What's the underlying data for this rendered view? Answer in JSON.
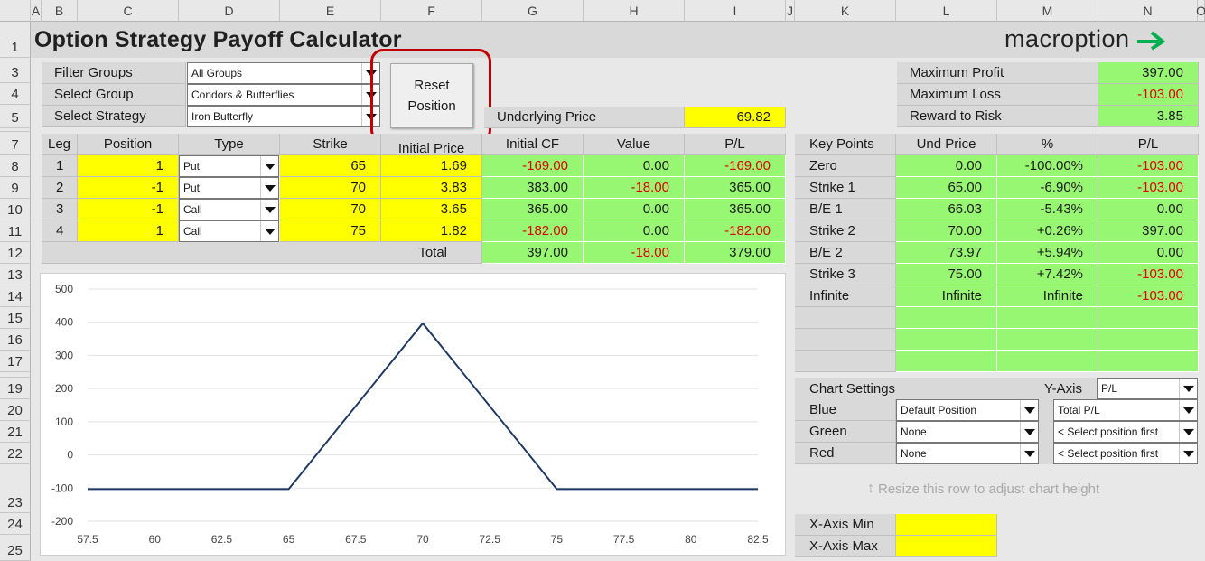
{
  "column_headers": [
    "A",
    "B",
    "C",
    "D",
    "E",
    "F",
    "G",
    "H",
    "I",
    "J",
    "K",
    "L",
    "M",
    "N",
    "O"
  ],
  "row_headers": [
    "1",
    "3",
    "4",
    "5",
    "7",
    "8",
    "9",
    "10",
    "11",
    "12",
    "13",
    "14",
    "15",
    "16",
    "17",
    "19",
    "20",
    "21",
    "22",
    "23",
    "24",
    "25"
  ],
  "title": "Option Strategy Payoff Calculator",
  "logo": {
    "text": "macroption",
    "accent": "#00b050"
  },
  "filters": [
    {
      "label": "Filter Groups",
      "value": "All Groups"
    },
    {
      "label": "Select Group",
      "value": "Condors & Butterflies"
    },
    {
      "label": "Select Strategy",
      "value": "Iron Butterfly"
    }
  ],
  "reset_button": {
    "line1": "Reset",
    "line2": "Position"
  },
  "underlying": {
    "label": "Underlying Price",
    "value": "69.82"
  },
  "summary": [
    {
      "label": "Maximum Profit",
      "value": "397.00",
      "negative": false
    },
    {
      "label": "Maximum Loss",
      "value": "-103.00",
      "negative": true
    },
    {
      "label": "Reward to Risk",
      "value": "3.85",
      "negative": false
    }
  ],
  "legs_table": {
    "headers": [
      "Leg",
      "Position",
      "Type",
      "Strike",
      "Initial Price",
      "Initial CF",
      "Value",
      "P/L"
    ],
    "rows": [
      {
        "leg": "1",
        "position": "1",
        "type": "Put",
        "strike": "65",
        "price": "1.69",
        "cf": "-169.00",
        "value": "0.00",
        "pl": "-169.00"
      },
      {
        "leg": "2",
        "position": "-1",
        "type": "Put",
        "strike": "70",
        "price": "3.83",
        "cf": "383.00",
        "value": "-18.00",
        "pl": "365.00"
      },
      {
        "leg": "3",
        "position": "-1",
        "type": "Call",
        "strike": "70",
        "price": "3.65",
        "cf": "365.00",
        "value": "0.00",
        "pl": "365.00"
      },
      {
        "leg": "4",
        "position": "1",
        "type": "Call",
        "strike": "75",
        "price": "1.82",
        "cf": "-182.00",
        "value": "0.00",
        "pl": "-182.00"
      }
    ],
    "total": {
      "label": "Total",
      "cf": "397.00",
      "value": "-18.00",
      "pl": "379.00"
    }
  },
  "key_points": {
    "headers": [
      "Key Points",
      "Und Price",
      "%",
      "P/L"
    ],
    "rows": [
      {
        "name": "Zero",
        "und": "0.00",
        "pct": "-100.00%",
        "pl": "-103.00"
      },
      {
        "name": "Strike 1",
        "und": "65.00",
        "pct": "-6.90%",
        "pl": "-103.00"
      },
      {
        "name": "B/E 1",
        "und": "66.03",
        "pct": "-5.43%",
        "pl": "0.00"
      },
      {
        "name": "Strike 2",
        "und": "70.00",
        "pct": "+0.26%",
        "pl": "397.00"
      },
      {
        "name": "B/E 2",
        "und": "73.97",
        "pct": "+5.94%",
        "pl": "0.00"
      },
      {
        "name": "Strike 3",
        "und": "75.00",
        "pct": "+7.42%",
        "pl": "-103.00"
      },
      {
        "name": "Infinite",
        "und": "Infinite",
        "pct": "Infinite",
        "pl": "-103.00"
      }
    ]
  },
  "chart_settings": {
    "title": "Chart Settings",
    "yaxis_label": "Y-Axis",
    "yaxis_value": "P/L",
    "rows": [
      {
        "label": "Blue",
        "position": "Default Position",
        "series": "Total P/L"
      },
      {
        "label": "Green",
        "position": "None",
        "series": "< Select position first"
      },
      {
        "label": "Red",
        "position": "None",
        "series": "< Select position first"
      }
    ]
  },
  "resize_hint": "Resize this row to adjust chart height",
  "xaxis": {
    "min_label": "X-Axis Min",
    "max_label": "X-Axis Max"
  },
  "chart_data": {
    "type": "line",
    "x": [
      57.5,
      65,
      70,
      75,
      82.5
    ],
    "series": [
      {
        "values": [
          -103,
          -103,
          397,
          -103,
          -103
        ],
        "color": "#203864"
      }
    ],
    "xticks": [
      "57.5",
      "60",
      "62.5",
      "65",
      "67.5",
      "70",
      "72.5",
      "75",
      "77.5",
      "80",
      "82.5"
    ],
    "yticks": [
      "-200",
      "-100",
      "0",
      "100",
      "200",
      "300",
      "400",
      "500"
    ],
    "xlim": [
      57.5,
      82.5
    ],
    "ylim": [
      -200,
      500
    ],
    "grid": true
  }
}
